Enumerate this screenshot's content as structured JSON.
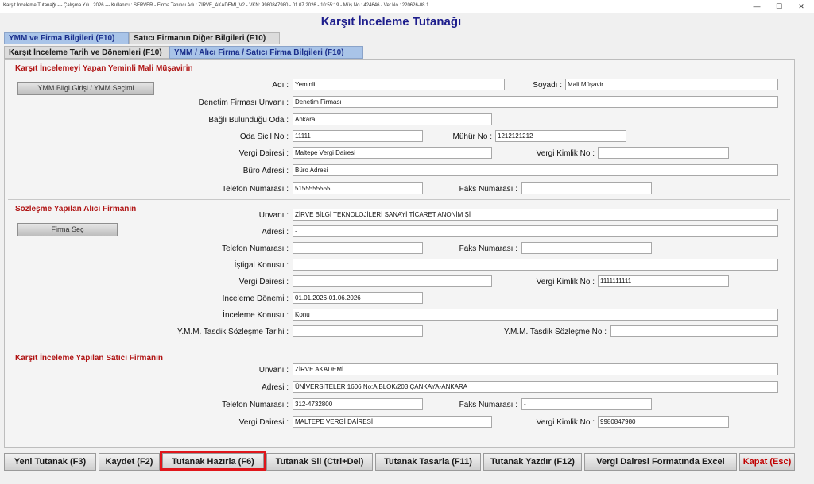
{
  "window": {
    "title": "Karşıt İnceleme Tutanağı  ---  Çalışma Yılı : 2026  ---  Kullanıcı : SERVER - Firma Tanıtıcı Adı : ZİRVE_AKADEMİ_V2 - VKN: 9980847980 - 01.07.2026 - 10:55:19 - Müş.No : 424646 - Ver.No : 220626-08.1",
    "minimize": "—",
    "maximize": "☐",
    "close": "✕"
  },
  "page_title": "Karşıt İnceleme Tutanağı",
  "tabs_row1": [
    "YMM ve Firma Bilgileri (F10)",
    "Satıcı Firmanın Diğer Bilgileri (F10)"
  ],
  "tabs_row2": [
    "Karşıt İnceleme Tarih ve Dönemleri (F10)",
    "YMM / Alıcı Firma / Satıcı Firma Bilgileri (F10)"
  ],
  "section1": {
    "title": "Karşıt İncelemeyi Yapan Yeminli Mali Müşavirin",
    "button": "YMM Bilgi Girişi / YMM Seçimi",
    "labels": {
      "adi": "Adı :",
      "soyadi": "Soyadı :",
      "denetim": "Denetim Firması Unvanı :",
      "oda": "Bağlı Bulunduğu Oda :",
      "sicil": "Oda Sicil No :",
      "muhur": "Mühür No :",
      "vd": "Vergi Dairesi :",
      "vkn": "Vergi Kimlik No :",
      "buro": "Büro Adresi :",
      "tel": "Telefon Numarası :",
      "faks": "Faks Numarası :"
    },
    "values": {
      "adi": "Yeminli",
      "soyadi": "Mali Müşavir",
      "denetim": "Denetim Firması",
      "oda": "Ankara",
      "sicil": "11111",
      "muhur": "1212121212",
      "vd": "Maltepe Vergi Dairesi",
      "vkn": "",
      "buro": "Büro Adresi",
      "tel": "5155555555",
      "faks": ""
    }
  },
  "section2": {
    "title": "Sözleşme Yapılan Alıcı Firmanın",
    "button": "Firma Seç",
    "labels": {
      "unvan": "Unvanı :",
      "adres": "Adresi :",
      "tel": "Telefon Numarası :",
      "faks": "Faks Numarası :",
      "istigal": "İştigal Konusu :",
      "vd": "Vergi Dairesi :",
      "vkn": "Vergi Kimlik No :",
      "donem": "İnceleme Dönemi :",
      "konu": "İnceleme Konusu :",
      "tarih": "Y.M.M. Tasdik Sözleşme Tarihi :",
      "sozno": "Y.M.M. Tasdik Sözleşme No :"
    },
    "values": {
      "unvan": "ZİRVE BİLGİ TEKNOLOJİLERİ SANAYİ TİCARET ANONİM Şİ",
      "adres": "-",
      "tel": "",
      "faks": "",
      "istigal": "",
      "vd": "",
      "vkn": "1111111111",
      "donem": "01.01.2026-01.06.2026",
      "konu": "Konu",
      "tarih": "",
      "sozno": ""
    }
  },
  "section3": {
    "title": "Karşıt İnceleme Yapılan Satıcı Firmanın",
    "labels": {
      "unvan": "Unvanı :",
      "adres": "Adresi :",
      "tel": "Telefon Numarası :",
      "faks": "Faks Numarası :",
      "vd": "Vergi Dairesi :",
      "vkn": "Vergi Kimlik No :"
    },
    "values": {
      "unvan": "ZİRVE AKADEMİ",
      "adres": "ÜNİVERSİTELER  1606  No:A BLOK/203  ÇANKAYA-ANKARA",
      "tel": "312-4732800",
      "faks": "-",
      "vd": "MALTEPE VERGİ DAİRESİ",
      "vkn": "9980847980"
    }
  },
  "bottom_buttons": [
    "Yeni Tutanak (F3)",
    "Kaydet (F2)",
    "Tutanak Hazırla (F6)",
    "Tutanak Sil (Ctrl+Del)",
    "Tutanak Tasarla (F11)",
    "Tutanak Yazdır (F12)",
    "Vergi Dairesi Formatında Excel",
    "Kapat (Esc)"
  ],
  "colors": {
    "section_title": "#b01414",
    "page_title": "#1d1d8c",
    "selected_tab": "#a9c4e8",
    "highlight_box": "#e0161b",
    "close_button_text": "#c00000"
  }
}
